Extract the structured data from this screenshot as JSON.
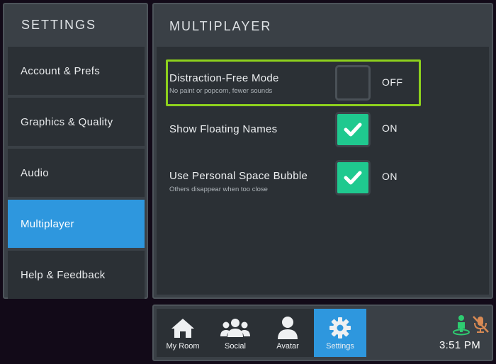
{
  "sidebar": {
    "title": "SETTINGS",
    "items": [
      {
        "label": "Account & Prefs"
      },
      {
        "label": "Graphics & Quality"
      },
      {
        "label": "Audio"
      },
      {
        "label": "Multiplayer"
      },
      {
        "label": "Help & Feedback"
      }
    ],
    "active_item": "Multiplayer"
  },
  "main": {
    "title": "MULTIPLAYER",
    "options": [
      {
        "label": "Distraction-Free Mode",
        "subtitle": "No paint or popcorn, fewer sounds",
        "checked": false,
        "state": "OFF"
      },
      {
        "label": "Show Floating Names",
        "subtitle": "",
        "checked": true,
        "state": "ON"
      },
      {
        "label": "Use Personal Space Bubble",
        "subtitle": "Others disappear when too close",
        "checked": true,
        "state": "ON"
      }
    ]
  },
  "nav": {
    "items": [
      {
        "label": "My Room",
        "icon": "home-icon"
      },
      {
        "label": "Social",
        "icon": "people-icon"
      },
      {
        "label": "Avatar",
        "icon": "avatar-icon"
      },
      {
        "label": "Settings",
        "icon": "gear-icon"
      }
    ],
    "active_item": "Settings"
  },
  "status": {
    "time": "3:51 PM",
    "player_icon": "player-presence-icon",
    "mic_icon": "mic-muted-icon"
  },
  "colors": {
    "accent_blue": "#2e97de",
    "check_green": "#1fc98f",
    "highlight_green": "#8ed11d",
    "mute_orange": "#d88a54",
    "presence_green": "#2ecc71"
  }
}
